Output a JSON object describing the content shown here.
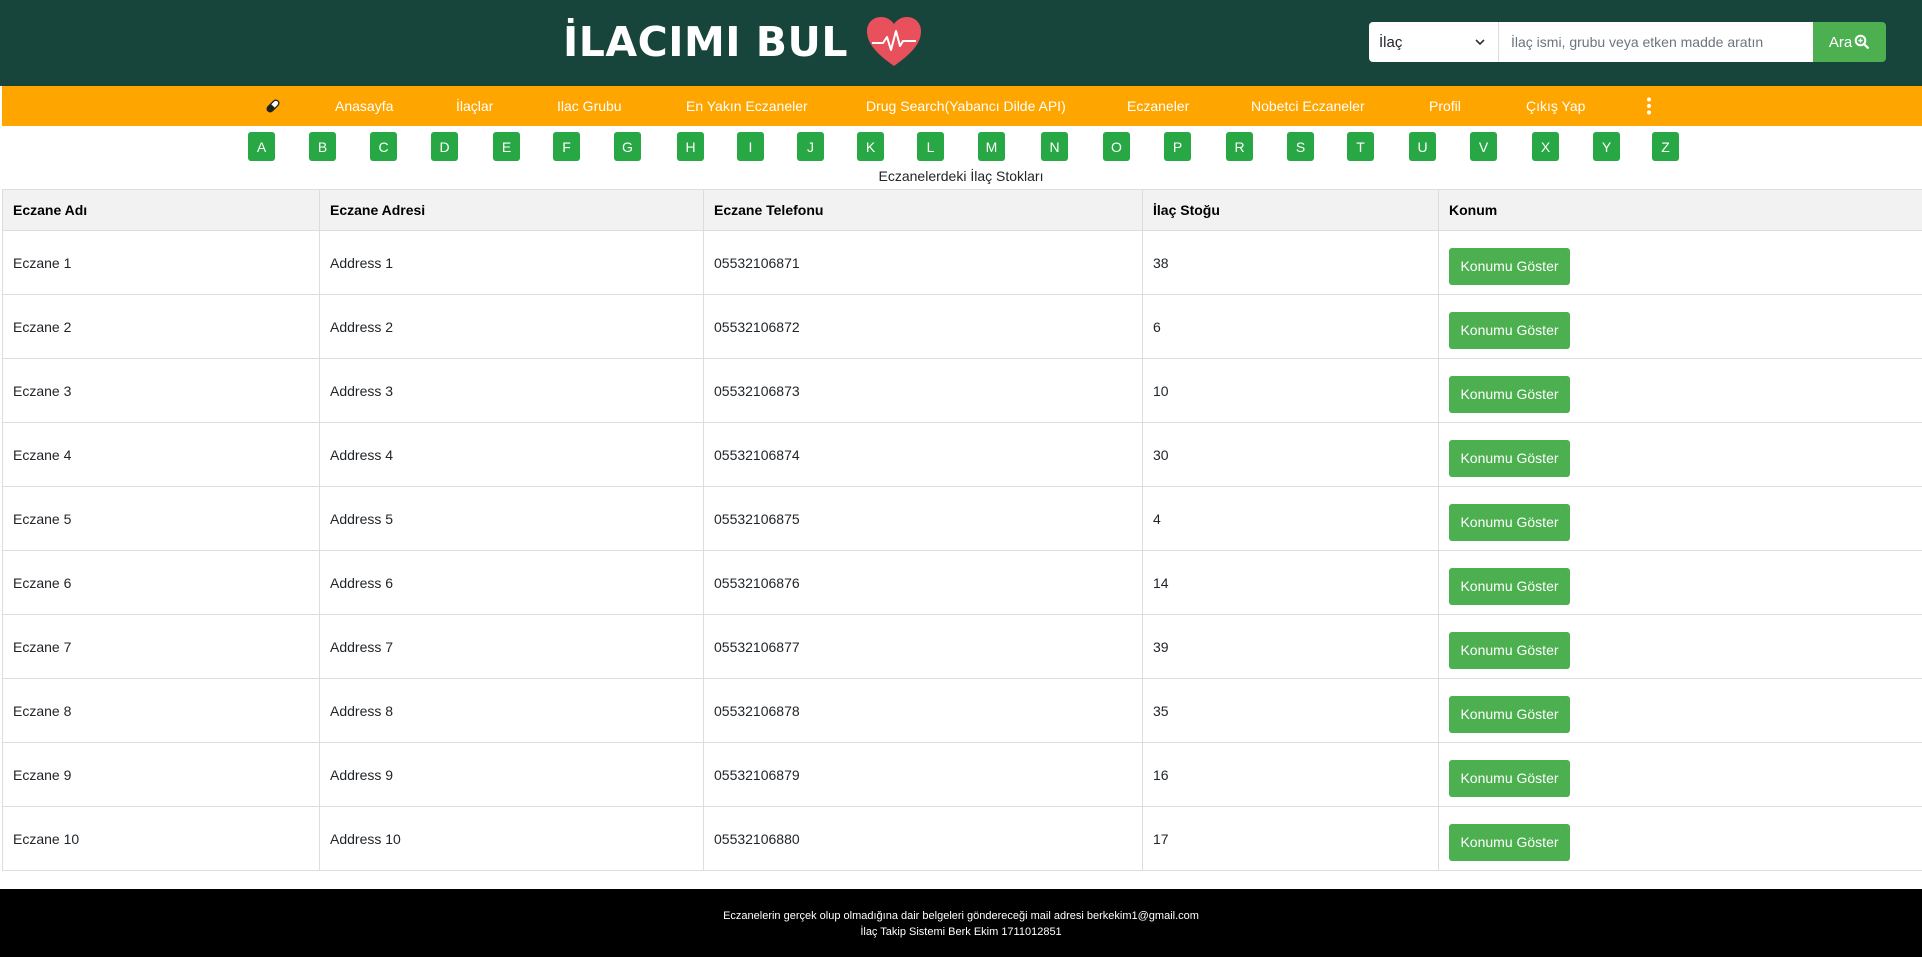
{
  "header": {
    "title": "İLACIMI BUL",
    "logo_icon": "heart-pulse-icon",
    "search": {
      "select_value": "İlaç",
      "placeholder": "İlaç ismi, grubu veya etken madde aratın",
      "button_label": "Ara"
    }
  },
  "nav": {
    "icon": "pill-icon",
    "items": [
      {
        "label": "Anasayfa"
      },
      {
        "label": "İlaçlar"
      },
      {
        "label": "Ilac Grubu"
      },
      {
        "label": "En Yakın Eczaneler"
      },
      {
        "label": "Drug Search(Yabancı Dilde API)"
      },
      {
        "label": "Eczaneler"
      },
      {
        "label": "Nobetci Eczaneler"
      },
      {
        "label": "Profil"
      },
      {
        "label": "Çıkış Yap"
      }
    ],
    "more_icon": "vertical-dots-icon"
  },
  "alphabet": [
    "A",
    "B",
    "C",
    "D",
    "E",
    "F",
    "G",
    "H",
    "I",
    "J",
    "K",
    "L",
    "M",
    "N",
    "O",
    "P",
    "R",
    "S",
    "T",
    "U",
    "V",
    "X",
    "Y",
    "Z"
  ],
  "table": {
    "caption": "Eczanelerdeki İlaç Stokları",
    "headers": [
      "Eczane Adı",
      "Eczane Adresi",
      "Eczane Telefonu",
      "İlaç Stoğu",
      "Konum"
    ],
    "button_label": "Konumu Göster",
    "rows": [
      {
        "name": "Eczane 1",
        "address": "Address 1",
        "phone": "05532106871",
        "stock": "38"
      },
      {
        "name": "Eczane 2",
        "address": "Address 2",
        "phone": "05532106872",
        "stock": "6"
      },
      {
        "name": "Eczane 3",
        "address": "Address 3",
        "phone": "05532106873",
        "stock": "10"
      },
      {
        "name": "Eczane 4",
        "address": "Address 4",
        "phone": "05532106874",
        "stock": "30"
      },
      {
        "name": "Eczane 5",
        "address": "Address 5",
        "phone": "05532106875",
        "stock": "4"
      },
      {
        "name": "Eczane 6",
        "address": "Address 6",
        "phone": "05532106876",
        "stock": "14"
      },
      {
        "name": "Eczane 7",
        "address": "Address 7",
        "phone": "05532106877",
        "stock": "39"
      },
      {
        "name": "Eczane 8",
        "address": "Address 8",
        "phone": "05532106878",
        "stock": "35"
      },
      {
        "name": "Eczane 9",
        "address": "Address 9",
        "phone": "05532106879",
        "stock": "16"
      },
      {
        "name": "Eczane 10",
        "address": "Address 10",
        "phone": "05532106880",
        "stock": "17"
      }
    ]
  },
  "footer": {
    "line1": "Eczanelerin gerçek olup olmadığına dair belgeleri göndereceği mail adresi berkekim1@gmail.com",
    "line2": "İlaç Takip Sistemi Berk Ekim 1711012851"
  },
  "colors": {
    "header_bg": "#18453b",
    "nav_bg": "#ffa500",
    "accent_green": "#4caf50",
    "letter_green": "#28a745",
    "heart_red": "#e8505b",
    "footer_bg": "#000000"
  }
}
